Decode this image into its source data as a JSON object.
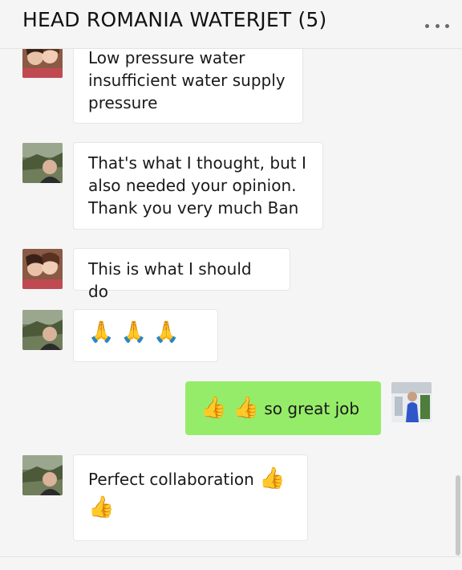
{
  "header": {
    "title": "HEAD ROMANIA WATERJET  (5)",
    "more_icon": "more-dots-icon"
  },
  "messages": [
    {
      "sender": "woman-couple",
      "lines": [
        "Low pressure water",
        "insufficient water supply",
        "pressure"
      ]
    },
    {
      "sender": "man",
      "lines": [
        "That's what I thought, but I",
        "also needed your opinion.",
        "Thank you very much Ban"
      ]
    },
    {
      "sender": "woman-couple",
      "lines": [
        "This is what I should do"
      ]
    },
    {
      "sender": "man",
      "emoji": "🙏 🙏 🙏"
    },
    {
      "sender": "self",
      "emoji": "👍 👍",
      "text": " so great job"
    },
    {
      "sender": "man",
      "text": "Perfect collaboration ",
      "emoji_inline": "👍",
      "emoji_line2": "👍"
    }
  ],
  "colors": {
    "background": "#f5f5f5",
    "bubble_incoming": "#ffffff",
    "bubble_outgoing": "#95ec69"
  }
}
